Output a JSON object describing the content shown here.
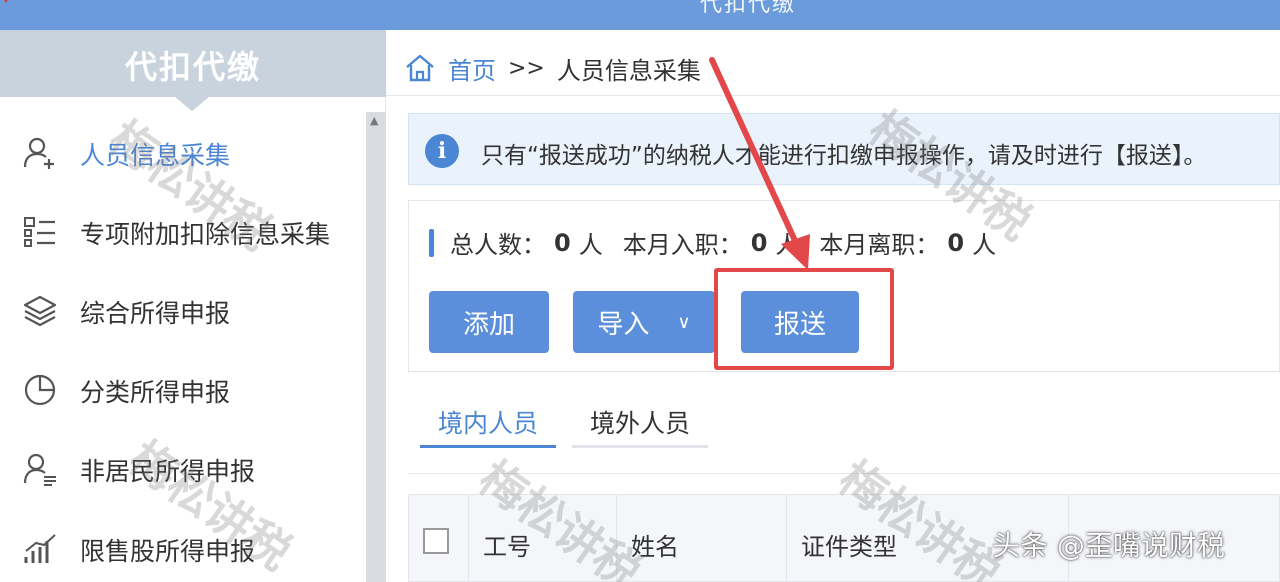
{
  "window": {
    "title": "代扣代缴"
  },
  "sidebar": {
    "header": "代扣代缴",
    "items": [
      {
        "label": "人员信息采集",
        "icon": "person-add-icon",
        "active": true
      },
      {
        "label": "专项附加扣除信息采集",
        "icon": "list-icon",
        "active": false
      },
      {
        "label": "综合所得申报",
        "icon": "layers-icon",
        "active": false
      },
      {
        "label": "分类所得申报",
        "icon": "pie-chart-icon",
        "active": false
      },
      {
        "label": "非居民所得申报",
        "icon": "person-card-icon",
        "active": false
      },
      {
        "label": "限售股所得申报",
        "icon": "bar-chart-icon",
        "active": false
      }
    ]
  },
  "breadcrumb": {
    "home": "首页",
    "separator": ">>",
    "current": "人员信息采集"
  },
  "notice": {
    "text": "只有“报送成功”的纳税人才能进行扣缴申报操作，请及时进行【报送】。"
  },
  "stats": {
    "total_label": "总人数：",
    "total_value": "0",
    "total_unit": "人",
    "hired_label": "本月入职：",
    "hired_value": "0",
    "hired_unit": "人",
    "left_label": "本月离职：",
    "left_value": "0",
    "left_unit": "人"
  },
  "actions": {
    "add": "添加",
    "import": "导入",
    "send": "报送"
  },
  "tabs": [
    {
      "label": "境内人员",
      "active": true
    },
    {
      "label": "境外人员",
      "active": false
    }
  ],
  "table": {
    "columns": [
      "工号",
      "姓名",
      "证件类型"
    ]
  },
  "watermark": {
    "text": "梅松讲税"
  },
  "credit": {
    "text": "头条 @歪嘴说财税"
  },
  "colors": {
    "accent": "#4a86d4",
    "highlight": "#e2474a",
    "topbar": "#6c9bdc"
  }
}
